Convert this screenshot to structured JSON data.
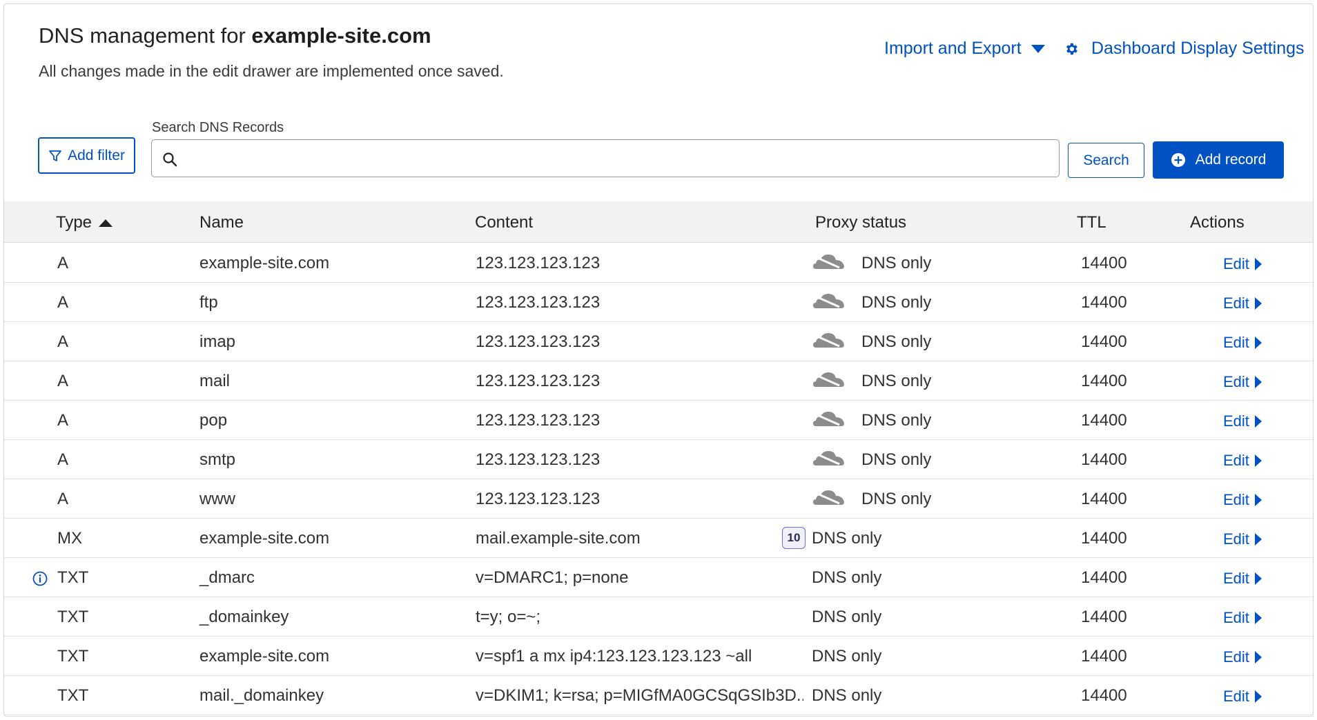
{
  "header": {
    "title_prefix": "DNS management for ",
    "title_domain": "example-site.com",
    "subtitle": "All changes made in the edit drawer are implemented once saved.",
    "import_export_label": "Import and Export",
    "display_settings_label": "Dashboard Display Settings"
  },
  "toolbar": {
    "add_filter_label": "Add filter",
    "search_label": "Search DNS Records",
    "search_value": "",
    "search_button_label": "Search",
    "add_record_label": "Add record"
  },
  "table": {
    "columns": {
      "type": "Type",
      "name": "Name",
      "content": "Content",
      "proxy": "Proxy status",
      "ttl": "TTL",
      "actions": "Actions"
    },
    "edit_label": "Edit",
    "rows": [
      {
        "type": "A",
        "name": "example-site.com",
        "content": "123.123.123.123",
        "proxy": "DNS only",
        "ttl": "14400"
      },
      {
        "type": "A",
        "name": "ftp",
        "content": "123.123.123.123",
        "proxy": "DNS only",
        "ttl": "14400"
      },
      {
        "type": "A",
        "name": "imap",
        "content": "123.123.123.123",
        "proxy": "DNS only",
        "ttl": "14400"
      },
      {
        "type": "A",
        "name": "mail",
        "content": "123.123.123.123",
        "proxy": "DNS only",
        "ttl": "14400"
      },
      {
        "type": "A",
        "name": "pop",
        "content": "123.123.123.123",
        "proxy": "DNS only",
        "ttl": "14400"
      },
      {
        "type": "A",
        "name": "smtp",
        "content": "123.123.123.123",
        "proxy": "DNS only",
        "ttl": "14400"
      },
      {
        "type": "A",
        "name": "www",
        "content": "123.123.123.123",
        "proxy": "DNS only",
        "ttl": "14400"
      },
      {
        "type": "MX",
        "name": "example-site.com",
        "content": "mail.example-site.com",
        "priority": "10",
        "proxy": "DNS only",
        "ttl": "14400"
      },
      {
        "type": "TXT",
        "name": "_dmarc",
        "content": "v=DMARC1; p=none",
        "proxy": "DNS only",
        "ttl": "14400"
      },
      {
        "type": "TXT",
        "name": "_domainkey",
        "content": "t=y; o=~;",
        "proxy": "DNS only",
        "ttl": "14400"
      },
      {
        "type": "TXT",
        "name": "example-site.com",
        "content": "v=spf1 a mx ip4:123.123.123.123 ~all",
        "proxy": "DNS only",
        "ttl": "14400"
      },
      {
        "type": "TXT",
        "name": "mail._domainkey",
        "content": "v=DKIM1; k=rsa; p=MIGfMA0GCSqGSIb3D...",
        "proxy": "DNS only",
        "ttl": "14400"
      }
    ]
  },
  "colors": {
    "accent": "#0051c3",
    "header_bg": "#f2f2f2",
    "cloud_gray": "#8c8c8c"
  },
  "icons": {
    "cloud": "cloud-dns-only-icon",
    "info": "info-icon",
    "gear": "gear-icon",
    "filter": "filter-icon",
    "search": "search-icon",
    "plus": "plus-circle-icon"
  }
}
